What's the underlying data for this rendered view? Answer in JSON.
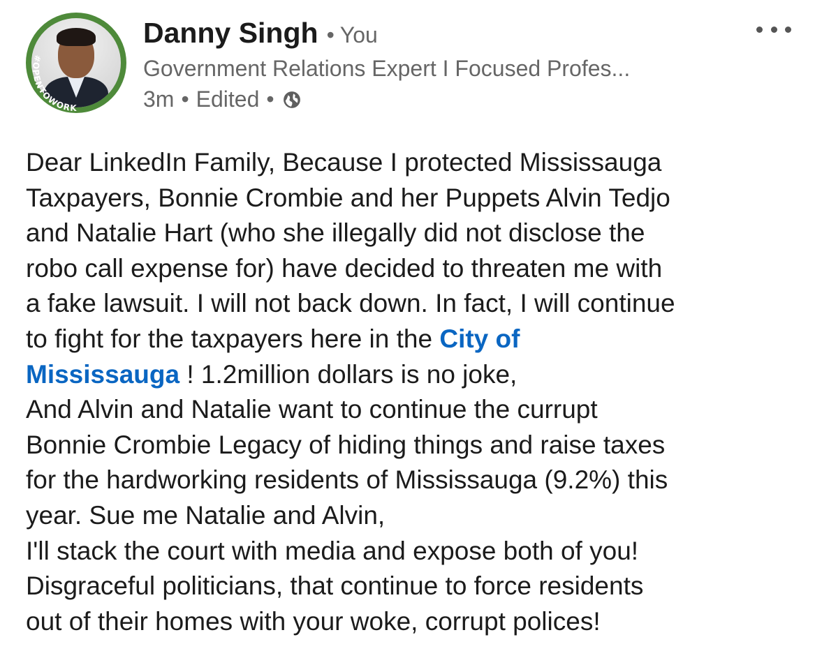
{
  "author": {
    "name": "Danny Singh",
    "separator": "•",
    "degree": "You",
    "headline": "Government Relations Expert I Focused Profes...",
    "badge_text": "#OPENTOWORK"
  },
  "meta": {
    "time": "3m",
    "edited": "Edited",
    "visibility_icon": "globe-icon"
  },
  "menu": {
    "icon": "more-horizontal-icon"
  },
  "post": {
    "lines": [
      "Dear LinkedIn Family, Because I protected Mississauga",
      "Taxpayers, Bonnie Crombie and her Puppets Alvin Tedjo",
      "and Natalie Hart (who she illegally did not disclose the",
      "robo call expense for) have decided to threaten me with",
      "a fake lawsuit. I will not back down. In fact, I will continue",
      "to fight for the taxpayers here in the "
    ],
    "mention_part1": "City of",
    "mention_part2": "Mississauga",
    "after_mention": " ! 1.2million dollars is no joke,",
    "lines_after": [
      "And Alvin and Natalie want to continue the currupt",
      "Bonnie Crombie Legacy of hiding things and raise taxes",
      "for the hardworking residents of Mississauga (9.2%) this",
      "year. Sue me Natalie and Alvin,",
      "I'll stack the court with media and expose both of you!",
      "Disgraceful politicians, that continue to force residents",
      "out of their homes with your woke, corrupt polices!"
    ]
  },
  "colors": {
    "link": "#0a66c2",
    "badge": "#4e8a3a",
    "secondary_text": "#666666"
  }
}
